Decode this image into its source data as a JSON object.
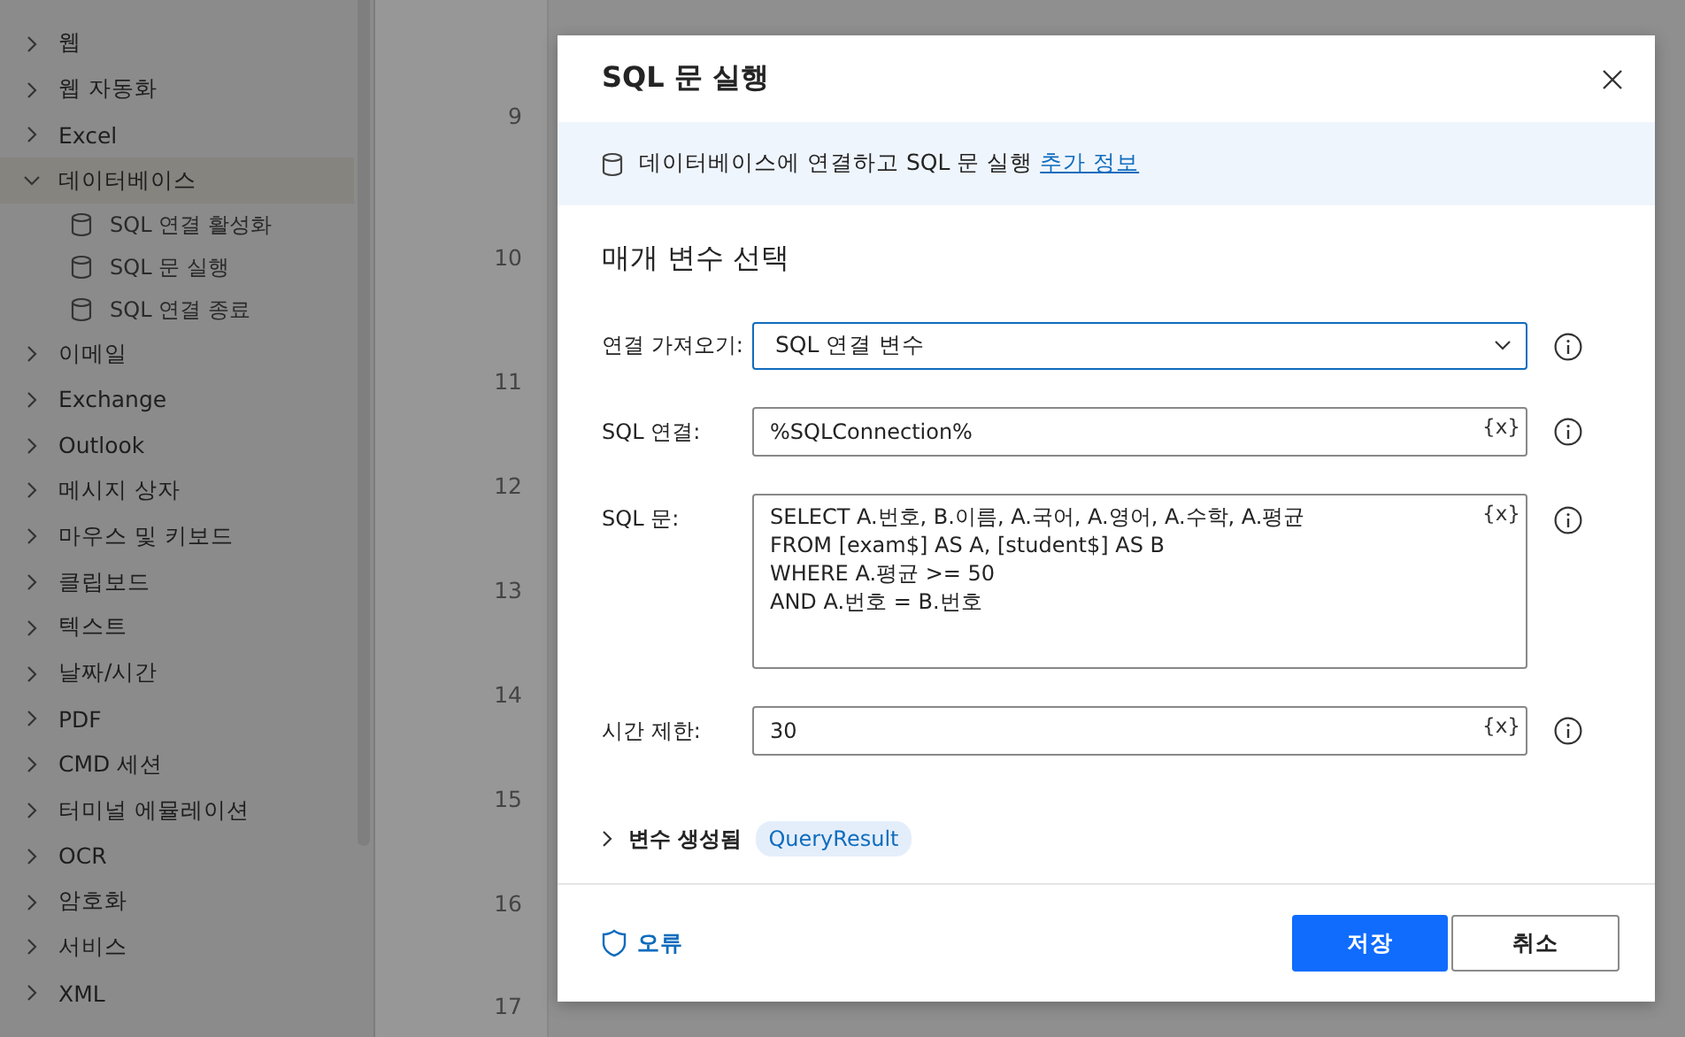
{
  "sidebar": {
    "items": [
      {
        "label": "웹",
        "expanded": false,
        "selected": false
      },
      {
        "label": "웹 자동화",
        "expanded": false,
        "selected": false
      },
      {
        "label": "Excel",
        "expanded": false,
        "selected": false
      },
      {
        "label": "데이터베이스",
        "expanded": true,
        "selected": true,
        "children": [
          {
            "label": "SQL 연결 활성화",
            "selected": false
          },
          {
            "label": "SQL 문 실행",
            "selected": false
          },
          {
            "label": "SQL 연결 종료",
            "selected": false
          }
        ]
      },
      {
        "label": "이메일",
        "expanded": false,
        "selected": false
      },
      {
        "label": "Exchange",
        "expanded": false,
        "selected": false
      },
      {
        "label": "Outlook",
        "expanded": false,
        "selected": false
      },
      {
        "label": "메시지 상자",
        "expanded": false,
        "selected": false
      },
      {
        "label": "마우스 및 키보드",
        "expanded": false,
        "selected": false
      },
      {
        "label": "클립보드",
        "expanded": false,
        "selected": false
      },
      {
        "label": "텍스트",
        "expanded": false,
        "selected": false
      },
      {
        "label": "날짜/시간",
        "expanded": false,
        "selected": false
      },
      {
        "label": "PDF",
        "expanded": false,
        "selected": false
      },
      {
        "label": "CMD 세션",
        "expanded": false,
        "selected": false
      },
      {
        "label": "터미널 에뮬레이션",
        "expanded": false,
        "selected": false
      },
      {
        "label": "OCR",
        "expanded": false,
        "selected": false
      },
      {
        "label": "암호화",
        "expanded": false,
        "selected": false
      },
      {
        "label": "서비스",
        "expanded": false,
        "selected": false
      },
      {
        "label": "XML",
        "expanded": false,
        "selected": false
      }
    ]
  },
  "gutter": {
    "line_numbers": [
      "9",
      "10",
      "11",
      "12",
      "13",
      "14",
      "15",
      "16",
      "17"
    ]
  },
  "dialog": {
    "title": "SQL 문 실행",
    "banner": {
      "text": "데이터베이스에 연결하고 SQL 문 실행",
      "link": "추가 정보"
    },
    "section_title": "매개 변수 선택",
    "fields": [
      {
        "kind": "dropdown",
        "label": "연결 가져오기:",
        "value": "SQL 연결 변수"
      },
      {
        "kind": "text",
        "label": "SQL 연결:",
        "value": "%SQLConnection%",
        "variable_button": "{x}"
      },
      {
        "kind": "multiline",
        "label": "SQL 문:",
        "value": "SELECT A.번호, B.이름, A.국어, A.영어, A.수학, A.평균\nFROM [exam$] AS A, [student$] AS B\nWHERE A.평균 >= 50\nAND A.번호 = B.번호",
        "variable_button": "{x}"
      },
      {
        "kind": "text",
        "label": "시간 제한:",
        "value": "30",
        "variable_button": "{x}"
      }
    ],
    "variables": {
      "label": "변수 생성됨",
      "expanded": false,
      "tags": [
        "QueryResult"
      ]
    },
    "footer": {
      "error_link": "오류",
      "buttons": [
        {
          "label": "저장",
          "kind": "primary"
        },
        {
          "label": "취소",
          "kind": "secondary"
        }
      ]
    }
  }
}
